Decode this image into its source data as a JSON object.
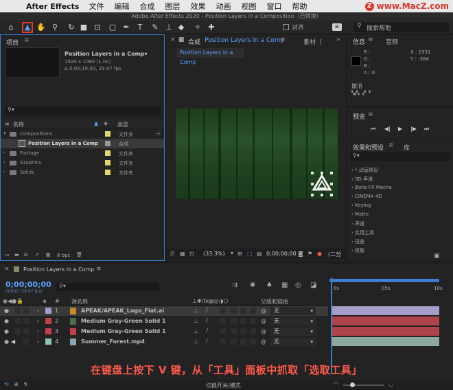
{
  "menubar": {
    "app_name": "After Effects",
    "items": [
      "文件",
      "编辑",
      "合成",
      "图层",
      "效果",
      "动画",
      "视图",
      "窗口",
      "帮助"
    ],
    "watermark": "www.MacZ.com"
  },
  "window_title": "Adobe After Effects 2020 - Position Layers in a Composition（已转换）",
  "toolbar": {
    "align_label": "对齐",
    "search_placeholder": "搜索帮助"
  },
  "project": {
    "tab": "项目",
    "comp_name": "Position Layers in a Comp▾",
    "comp_size": "1920 x 1080 (1.00)",
    "comp_duration": "Δ 0;00;10;00, 29.97 fps",
    "col_name": "名称",
    "col_type": "类型",
    "items": [
      {
        "name": "Compositions",
        "type": "文件夹"
      },
      {
        "name": "Position Layers in a Comp",
        "type": "合成"
      },
      {
        "name": "Footage",
        "type": "文件夹"
      },
      {
        "name": "Graphics",
        "type": "文件夹"
      },
      {
        "name": "Solids",
        "type": "文件夹"
      }
    ],
    "bpc": "8 bpc"
  },
  "composition": {
    "tab": "合成",
    "tab_name": "Position Layers in a Comp",
    "footage_tab": "素材（",
    "subtab": "Position Layers in a Comp",
    "zoom": "(33.3%)",
    "timecode": "0;00;00;00",
    "extra": "(二分"
  },
  "info": {
    "tab": "信息",
    "audio_tab": "音频",
    "r": "R :",
    "g": "G :",
    "b": "B :",
    "a": "A : 0",
    "x": "X : 1931",
    "y": "Y : -384",
    "undo_label": "撤消"
  },
  "preview": {
    "tab": "预览"
  },
  "effects": {
    "tab": "效果和预设",
    "library_tab": "库",
    "items": [
      "* 动画预设",
      "3D 声道",
      "Boris FX Mocha",
      "CINEMA 4D",
      "Keying",
      "Matte",
      "声道",
      "实用工具",
      "扭曲",
      "抠像"
    ]
  },
  "timeline": {
    "tab": "Position Layers in a Comp",
    "time": "0;00;00;00",
    "frames": "00000 (29.97 fps)",
    "col_source": "源名称",
    "col_parent": "父级和链接",
    "ruler": [
      "0s",
      "05s",
      "10s"
    ],
    "layers": [
      {
        "num": "1",
        "name": "APEAK/APEAK_Logo_Flat.ai",
        "parent": "无",
        "label_color": "#a79ad6",
        "bar_color": "#a49ec8"
      },
      {
        "num": "2",
        "name": "Medium Gray-Green Solid 1",
        "parent": "无",
        "label_color": "#c0404a",
        "bar_color": "#b0434c"
      },
      {
        "num": "3",
        "name": "Medium Gray-Green Solid 1",
        "parent": "无",
        "label_color": "#c0404a",
        "bar_color": "#b0434c"
      },
      {
        "num": "4",
        "name": "Summer_Forest.mp4",
        "parent": "无",
        "label_color": "#8fc4b4",
        "bar_color": "#8cab9e"
      }
    ],
    "toggle_label": "切换开关/模式"
  },
  "caption": "在键盘上按下 V 键，从「工具」面板中抓取「选取工具」"
}
